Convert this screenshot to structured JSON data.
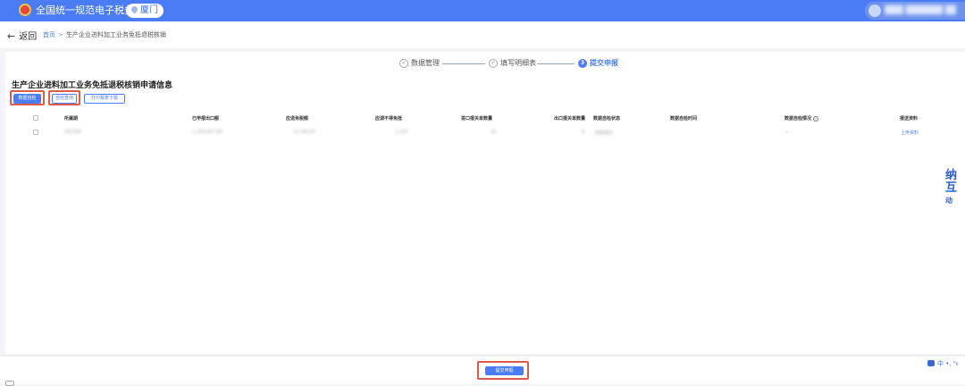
{
  "header": {
    "site_title": "全国统一规范电子税务局",
    "region": "厦门",
    "user_name": "███ ██████ ████"
  },
  "breadcrumb": {
    "back": "返回",
    "home": "首页",
    "separator": ">",
    "current": "生产企业进料加工业务免抵退税核销"
  },
  "steps": [
    {
      "label": "数据管理",
      "status": "done"
    },
    {
      "label": "填写明细表",
      "status": "done"
    },
    {
      "label": "提交申报",
      "status": "active",
      "number": "3"
    }
  ],
  "section_title": "生产企业进料加工业务免抵退税核销申请信息",
  "buttons": {
    "data_check": "数据自检",
    "check_query": "自检查询",
    "print_download": "打印报表下载",
    "submit": "提交申报"
  },
  "table": {
    "columns": [
      "所属期",
      "已申报出口额",
      "应退免税额",
      "应调不得免抵",
      "进口报关单数量",
      "出口报关单数量",
      "数据自检状态",
      "数据自检时间",
      "数据自检情况",
      "报送资料"
    ],
    "row": [
      "202306",
      "1,234,567.89",
      "12,345.67",
      "1,234",
      "16",
      "8",
      "自检成功",
      "",
      "--",
      "上传资料"
    ]
  },
  "float_tab": [
    "纳",
    "互",
    "动"
  ],
  "ime": {
    "lang": "中",
    "symbols": "•, ⁰₀"
  },
  "colors": {
    "primary": "#4a7cf5",
    "highlight": "#e05a4a",
    "topbar": "#4a7cf5"
  }
}
